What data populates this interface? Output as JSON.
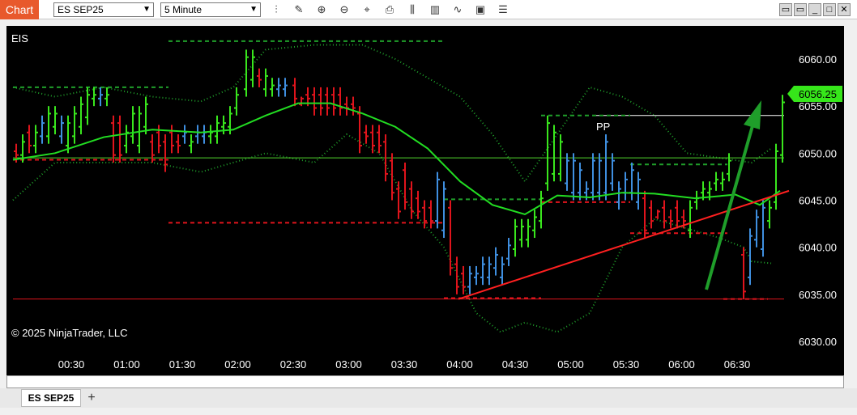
{
  "window": {
    "title": "Chart",
    "instrument": "ES SEP25",
    "interval": "5 Minute",
    "toolbar_icons": [
      "bar-type-icon",
      "draw-pencil-icon",
      "zoom-in-icon",
      "zoom-out-icon",
      "crosshair-icon",
      "data-box-icon",
      "indicators-icon",
      "strategies-icon",
      "properties-icon",
      "templates-icon"
    ],
    "controls": [
      "restore-icon",
      "restore2-icon",
      "minimize-icon",
      "maximize-icon",
      "close-icon"
    ]
  },
  "chart": {
    "label": "EIS",
    "copyright": "© 2025 NinjaTrader, LLC",
    "pp_label": "PP",
    "last_price": "6056.25",
    "y_ticks": [
      "6060.00",
      "6055.00",
      "6050.00",
      "6045.00",
      "6040.00",
      "6035.00",
      "6030.00"
    ],
    "x_ticks": [
      "00:30",
      "01:00",
      "01:30",
      "02:00",
      "02:30",
      "03:00",
      "03:30",
      "04:00",
      "04:30",
      "05:00",
      "05:30",
      "06:00",
      "06:30"
    ],
    "colors": {
      "up": "#39e61d",
      "down": "#e0141c",
      "neutral": "#3f8fe0",
      "ma": "#22dd22",
      "band": "#1f9e2a",
      "price_marker": "#36e61a"
    }
  },
  "chart_data": {
    "type": "candlestick",
    "ylim": [
      6028.0,
      6063.0
    ],
    "x": [
      "00:30",
      "01:00",
      "01:30",
      "02:00",
      "02:30",
      "03:00",
      "03:30",
      "04:00",
      "04:30",
      "05:00",
      "05:30",
      "06:00",
      "06:30"
    ],
    "horizontal_levels": [
      6049.5,
      6034.5
    ],
    "pp_level": 6054.0,
    "last_price": 6056.25
  },
  "tabs": {
    "active": "ES SEP25",
    "add": "+"
  }
}
